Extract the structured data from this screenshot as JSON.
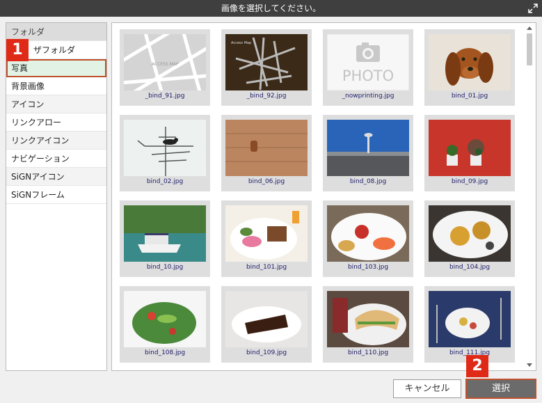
{
  "window": {
    "title": "画像を選択してください。"
  },
  "sidebar": {
    "items": [
      {
        "label": "フォルダ"
      },
      {
        "label": "ザフォルダ"
      },
      {
        "label": "写真"
      },
      {
        "label": "背景画像"
      },
      {
        "label": "アイコン"
      },
      {
        "label": "リンクアロー"
      },
      {
        "label": "リンクアイコン"
      },
      {
        "label": "ナビゲーション"
      },
      {
        "label": "SiGNアイコン"
      },
      {
        "label": "SiGNフレーム"
      }
    ]
  },
  "badges": {
    "step1": "1",
    "step2": "2"
  },
  "images": [
    {
      "name": "_bind_91.jpg",
      "thumb": "map-light"
    },
    {
      "name": "_bind_92.jpg",
      "thumb": "map-dark"
    },
    {
      "name": "_nowprinting.jpg",
      "thumb": "photo-placeholder"
    },
    {
      "name": "bind_01.jpg",
      "thumb": "dog"
    },
    {
      "name": "bind_02.jpg",
      "thumb": "antenna-bird"
    },
    {
      "name": "bind_06.jpg",
      "thumb": "brick-wall"
    },
    {
      "name": "bind_08.jpg",
      "thumb": "airport"
    },
    {
      "name": "bind_09.jpg",
      "thumb": "plants-red-wall"
    },
    {
      "name": "bind_10.jpg",
      "thumb": "boat"
    },
    {
      "name": "bind_101.jpg",
      "thumb": "breakfast"
    },
    {
      "name": "bind_103.jpg",
      "thumb": "plate-fruit"
    },
    {
      "name": "bind_104.jpg",
      "thumb": "pastries"
    },
    {
      "name": "bind_108.jpg",
      "thumb": "salad"
    },
    {
      "name": "bind_109.jpg",
      "thumb": "chocolate-cake"
    },
    {
      "name": "bind_110.jpg",
      "thumb": "sandwich"
    },
    {
      "name": "bind_111.jpg",
      "thumb": "dinner-table"
    }
  ],
  "placeholder": {
    "text": "PHOTO"
  },
  "map_label": {
    "text": "ACCESS MAP"
  },
  "map_label_dark": {
    "text": "Access Map"
  },
  "buttons": {
    "cancel": "キャンセル",
    "select": "選択"
  },
  "colors": {
    "highlight": "#c0502d",
    "badge": "#e02a18",
    "selected_bg": "#e2f3e6"
  }
}
